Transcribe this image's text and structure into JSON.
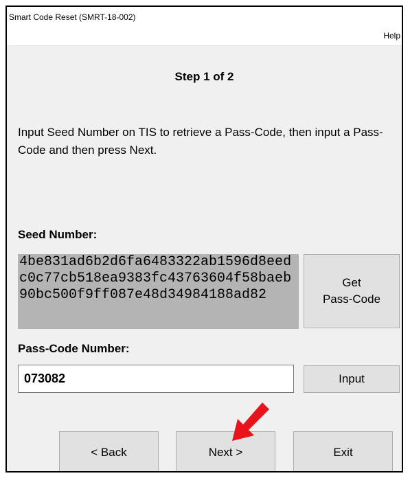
{
  "window": {
    "title": "Smart Code Reset (SMRT-18-002)"
  },
  "menu": {
    "help": "Help"
  },
  "step": {
    "title": "Step 1 of 2"
  },
  "instructions": "Input Seed Number on TIS to retrieve a Pass-Code, then input a Pass-Code and then press Next.",
  "seed": {
    "label": "Seed Number:",
    "value": "4be831ad6b2d6fa6483322ab1596d8eedc0c77cb518ea9383fc43763604f58baeb90bc500f9ff087e48d34984188ad82",
    "get_button_line1": "Get",
    "get_button_line2": "Pass-Code"
  },
  "passcode": {
    "label": "Pass-Code Number:",
    "value": "073082",
    "input_button": "Input"
  },
  "nav": {
    "back": "< Back",
    "next": "Next >",
    "exit": "Exit"
  },
  "colors": {
    "seed_background": "#b4b4b4",
    "button_face": "#e1e1e1",
    "window_background": "#f0f0f0",
    "annotation_arrow": "#e8141c"
  },
  "annotation": {
    "icon": "red-arrow-icon",
    "target": "next-button"
  }
}
